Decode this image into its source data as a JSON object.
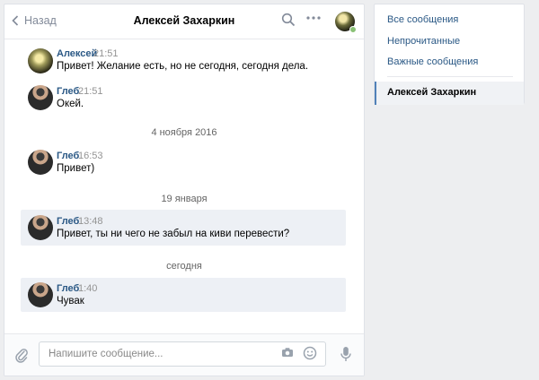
{
  "header": {
    "back_label": "Назад",
    "title": "Алексей Захаркин",
    "icons": [
      "search-icon",
      "more-icon",
      "avatar"
    ]
  },
  "messages": [
    {
      "author": "Алексей",
      "time": "21:51",
      "text": "Привет! Желание есть, но не сегодня, сегодня дела."
    },
    {
      "author": "Глеб",
      "time": "21:51",
      "text": "Окей."
    },
    {
      "author": "Глеб",
      "time": "16:53",
      "text": "Привет)"
    },
    {
      "author": "Глеб",
      "time": "13:48",
      "text": "Привет, ты ни чего не забыл на киви перевести?"
    },
    {
      "author": "Глеб",
      "time": "1:40",
      "text": "Чувак"
    }
  ],
  "date_separators": [
    "4 ноября 2016",
    "19 января",
    "сегодня"
  ],
  "composer": {
    "placeholder": "Напишите сообщение...",
    "icons": [
      "paperclip-icon",
      "camera-icon",
      "smile-icon",
      "microphone-icon"
    ]
  },
  "sidebar": {
    "items": [
      {
        "label": "Все сообщения"
      },
      {
        "label": "Непрочитанные"
      },
      {
        "label": "Важные сообщения"
      }
    ],
    "active": "Алексей Захаркин"
  },
  "colors": {
    "link": "#2a5885",
    "background": "#edeef0",
    "highlight": "#edf0f5",
    "accent": "#5181b8",
    "online": "#8ac176"
  }
}
